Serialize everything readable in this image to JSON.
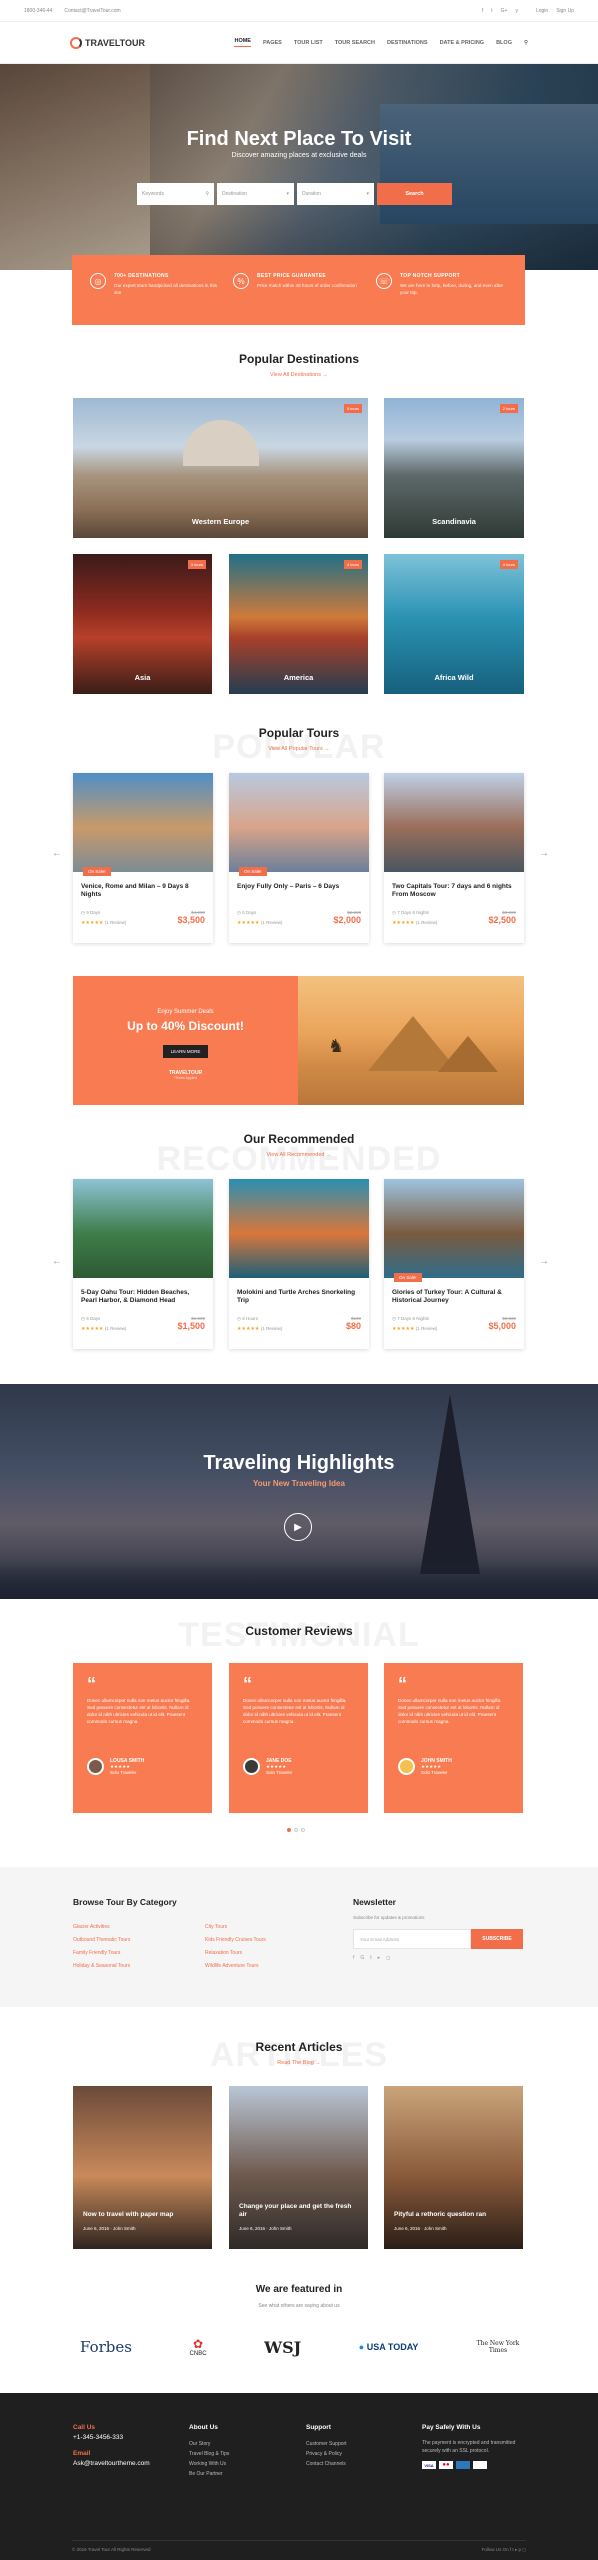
{
  "topbar": {
    "phone": "1800-346-44",
    "email": "Contact@TravelTour.com",
    "social": [
      "f",
      "t",
      "G+",
      "y"
    ],
    "login": "Login",
    "signup": "Sign Up"
  },
  "brand": {
    "name": "TRAVELTOUR"
  },
  "nav": [
    "HOME",
    "PAGES",
    "TOUR LIST",
    "TOUR SEARCH",
    "DESTINATIONS",
    "DATE & PRICING",
    "BLOG"
  ],
  "hero": {
    "title": "Find Next Place To Visit",
    "subtitle": "Discover amazing places at exclusive deals",
    "keywords": "Keywords",
    "destination": "Destination",
    "duration": "Duration",
    "search": "Search"
  },
  "features": [
    {
      "icon": "globe-icon",
      "glyph": "◎",
      "title": "700+ DESTINATIONS",
      "desc": "Our expert team handpicked all destinations in this site"
    },
    {
      "icon": "price-icon",
      "glyph": "%",
      "title": "BEST PRICE GUARANTEE",
      "desc": "Price match within 48 hours of order confirmation"
    },
    {
      "icon": "support-icon",
      "glyph": "☏",
      "title": "TOP NOTCH SUPPORT",
      "desc": "We are here to help, before, during, and even after your trip."
    }
  ],
  "destinations": {
    "title": "Popular Destinations",
    "link": "View All Destinations",
    "items": [
      {
        "name": "Western Europe",
        "badge": "5 tours"
      },
      {
        "name": "Scandinavia",
        "badge": "2 tours"
      },
      {
        "name": "Asia",
        "badge": "3 tours"
      },
      {
        "name": "America",
        "badge": "4 tours"
      },
      {
        "name": "Africa Wild",
        "badge": "4 tours"
      }
    ]
  },
  "tours": {
    "title": "Popular Tours",
    "watermark": "POPULAR",
    "link": "View All Popular Tours",
    "items": [
      {
        "title": "Venice, Rome and Milan – 9 Days 8 Nights",
        "days": "9 Days",
        "old": "$4,200",
        "price": "$3,500",
        "sale": "On Sale!",
        "reviews": "(1 Review)"
      },
      {
        "title": "Enjoy Fully Only – Paris – 6 Days",
        "days": "6 Days",
        "old": "$2,500",
        "price": "$2,000",
        "sale": "On Sale!",
        "reviews": "(1 Review)"
      },
      {
        "title": "Two Capitals Tour: 7 days and 6 nights From Moscow",
        "days": "7 Days 6 Nights",
        "old": "$3,300",
        "price": "$2,500",
        "sale": "",
        "reviews": "(1 Review)"
      }
    ]
  },
  "promo": {
    "small": "Enjoy Summer Deals",
    "big": "Up to 40% Discount!",
    "button": "LEARN MORE",
    "brand": "TRAVELTOUR",
    "note": "*Terms Applied"
  },
  "recommended": {
    "title": "Our Recommended",
    "watermark": "RECOMMENDED",
    "link": "View All Recommended",
    "items": [
      {
        "title": "5-Day Oahu Tour: Hidden Beaches, Pearl Harbor, & Diamond Head",
        "days": "5 Days",
        "old": "$1,800",
        "price": "$1,500",
        "sale": "",
        "reviews": "(1 Review)"
      },
      {
        "title": "Molokini and Turtle Arches Snorkeling Trip",
        "days": "8 Hours",
        "old": "$100",
        "price": "$80",
        "sale": "",
        "reviews": "(1 Review)"
      },
      {
        "title": "Glories of Turkey Tour: A Cultural & Historical Journey",
        "days": "7 Days 6 Nights",
        "old": "$5,500",
        "price": "$5,000",
        "sale": "On Sale!",
        "reviews": "(1 Review)"
      }
    ]
  },
  "video": {
    "title": "Traveling Highlights",
    "subtitle": "Your New Traveling Idea"
  },
  "reviews": {
    "title": "Customer Reviews",
    "watermark": "TESTIMONIAL",
    "items": [
      {
        "text": "Donec ullamcorper nulla non metus auctor fringilla. Sed posuere consectetur est at lobortis. Nullam id dolor id nibh ultricies vehicula ut id elit. Praesent commodo cursus magna.",
        "name": "LOUSA SMITH",
        "role": "Solo Traveler"
      },
      {
        "text": "Donec ullamcorper nulla non metus auctor fringilla. Sed posuere consectetur est at lobortis. Nullam id dolor id nibh ultricies vehicula ut id elit. Praesent commodo cursus magna.",
        "name": "JANE DOE",
        "role": "Solo Traveler"
      },
      {
        "text": "Donec ullamcorper nulla non metus auctor fringilla. Sed posuere consectetur est at lobortis. Nullam id dolor id nibh ultricies vehicula ut id elit. Praesent commodo cursus magna.",
        "name": "JOHN SMITH",
        "role": "Solo Traveler"
      }
    ]
  },
  "browse": {
    "title": "Browse Tour By Category",
    "col1": [
      "Glacier Activities",
      "Outbound Thematic Tours",
      "Family Friendly Tours",
      "Holiday & Seasonal Tours"
    ],
    "col2": [
      "City Tours",
      "Kids Friendly Cruises Tours",
      "Relaxation Tours",
      "Wildlife Adventure Tours"
    ]
  },
  "newsletter": {
    "title": "Newsletter",
    "desc": "Subscribe for updates & promotions",
    "placeholder": "Your Email Address",
    "button": "SUBSCRIBE"
  },
  "articles": {
    "title": "Recent Articles",
    "watermark": "ARTICLES",
    "link": "Read The Blog",
    "items": [
      {
        "title": "Now to travel with paper map",
        "date": "June 6, 2016",
        "author": "John Smith"
      },
      {
        "title": "Change your place and get the fresh air",
        "date": "June 6, 2016",
        "author": "John Smith"
      },
      {
        "title": "Pityful a rethoric question ran",
        "date": "June 6, 2016",
        "author": "John Smith"
      }
    ]
  },
  "featured": {
    "title": "We are featured in",
    "sub": "See what others are saying about us",
    "logos": [
      "Forbes",
      "CNBC",
      "WSJ",
      "USA TODAY",
      "The New York Times"
    ]
  },
  "footer": {
    "call": "Call Us",
    "phone": "+1-345-3456-333",
    "email_label": "Email",
    "email": "Ask@traveltourtheme.com",
    "about_title": "About Us",
    "about": [
      "Our Story",
      "Travel Blog & Tips",
      "Working With Us",
      "Be Our Partner"
    ],
    "support_title": "Support",
    "support": [
      "Customer Support",
      "Privacy & Policy",
      "Contact Channels"
    ],
    "pay_title": "Pay Safely With Us",
    "pay": "The payment is encrypted and transmitted securely with an SSL protocol.",
    "copyright": "© 2016 Travel Tour All Rights Reserved",
    "follow": "Follow Us On"
  }
}
